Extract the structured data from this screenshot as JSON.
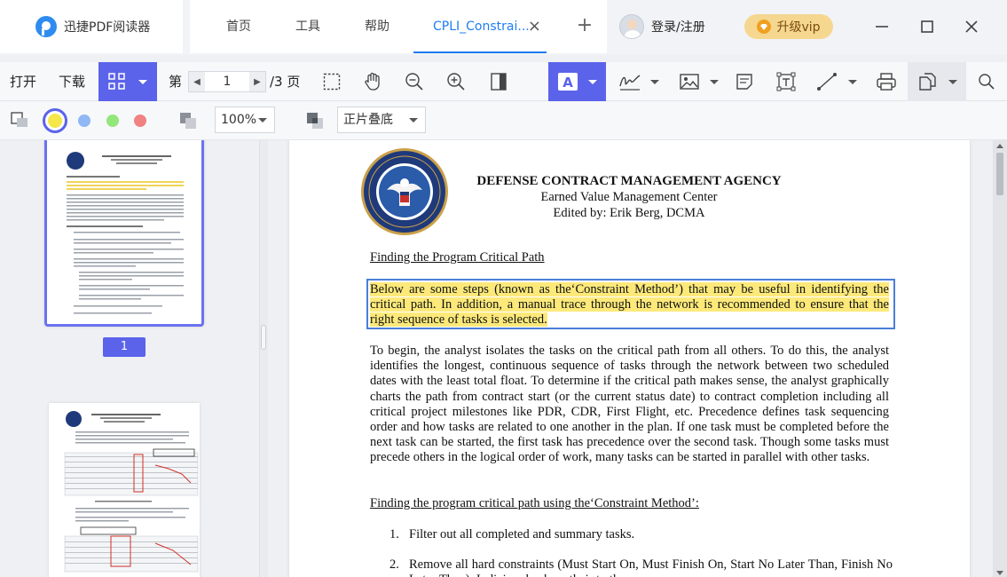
{
  "app": {
    "name": "迅捷PDF阅读器"
  },
  "tabs": [
    {
      "label": "首页"
    },
    {
      "label": "工具"
    },
    {
      "label": "帮助"
    },
    {
      "label": "CPLI_Constrai..."
    }
  ],
  "user": {
    "login_label": "登录/注册"
  },
  "vip": {
    "label": "升级vip"
  },
  "toolbar": {
    "open_label": "打开",
    "download_label": "下载",
    "page_prefix": "第",
    "current_page": "1",
    "page_total": "/3 页"
  },
  "subbar": {
    "zoom": "100%",
    "mode": "正片叠底",
    "colors": [
      "#f5e64a",
      "#8fb8f4",
      "#92e67a",
      "#f08282"
    ]
  },
  "sidebar": {
    "page_badge": "1"
  },
  "document": {
    "header_line1": "DEFENSE CONTRACT MANAGEMENT AGENCY",
    "header_line2": "Earned Value Management Center",
    "header_line3": "Edited by: Erik Berg, DCMA",
    "heading1": "Finding the Program Critical Path",
    "highlighted_paragraph": "Below are some steps (known as the‘Constraint Method’) that may be useful in identifying the critical path. In addition, a manual trace through the network is recommended to ensure that the right sequence of tasks is selected.",
    "paragraph2": "To begin, the analyst isolates the tasks on the critical path from all others. To do this, the analyst identifies the longest, continuous sequence of tasks through the network between two scheduled dates with the least total float. To determine if the critical path makes sense, the analyst graphically charts the path from contract start (or the current status date) to contract completion including all critical project milestones like PDR, CDR, First Flight, etc. Precedence defines task sequencing order and how tasks are related to one another in the plan. If one task must be completed before the next task can be started, the first task has precedence over the second task. Though some tasks must precede others in the logical order of work, many tasks can be started in parallel with other tasks.",
    "heading2": "Finding the program critical path using the‘Constraint Method’:",
    "list": [
      {
        "num": "1.",
        "text": "Filter out all completed and summary tasks."
      },
      {
        "num": "2.",
        "text": "Remove all hard constraints (Must Start On, Must Finish On, Start No Later Than, Finish No Later Than). Indicizas back on their to the"
      }
    ]
  }
}
